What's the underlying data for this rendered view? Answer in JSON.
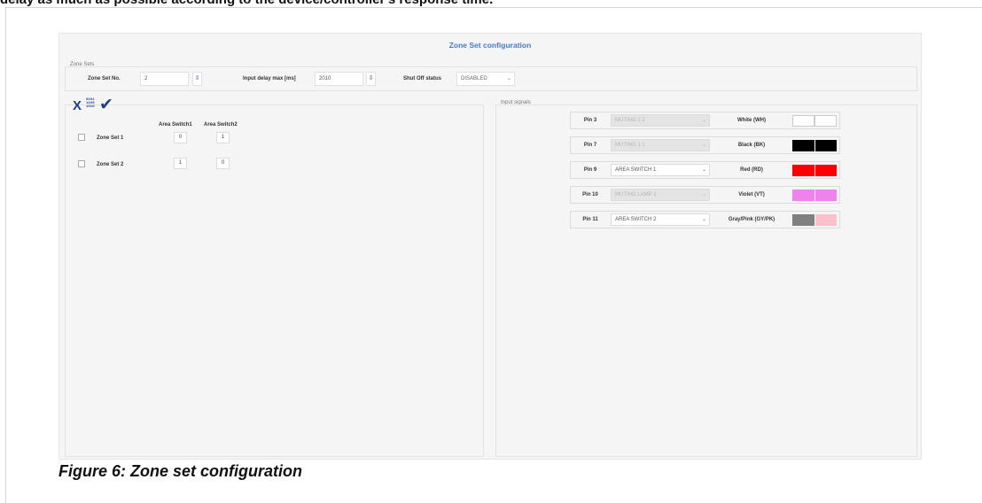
{
  "doc": {
    "top_text": "delay as much as possible according to the device/controller's response time.",
    "caption": "Figure 6: Zone set configuration"
  },
  "window": {
    "title": "Zone Set configuration"
  },
  "zone_sets_group": {
    "legend": "Zone Sets",
    "zone_set_no_label": "Zone Set No.",
    "zone_set_no_value": "2",
    "input_delay_label": "Input delay max [ms]",
    "input_delay_value": "2010",
    "shut_off_label": "Shut Off status",
    "shut_off_value": "DISABLED"
  },
  "toolbar": {
    "clear_icon": "x-icon",
    "binary_icon": "binary-icon",
    "binary_text": [
      "0101",
      "1100",
      "1010"
    ],
    "confirm_icon": "checkmark-icon",
    "icon_color": "#1f3f8a"
  },
  "zone_table": {
    "headers": [
      "Area Switch1",
      "Area Switch2"
    ],
    "rows": [
      {
        "label": "Zone Set 1",
        "checked": false,
        "area1": "0",
        "area2": "1"
      },
      {
        "label": "Zone Set 2",
        "checked": false,
        "area1": "1",
        "area2": "0"
      }
    ]
  },
  "input_signals": {
    "legend": "Input signals",
    "rows": [
      {
        "pin": "Pin 3",
        "function": "MUTING 1 2",
        "enabled": false,
        "wire": "White (WH)",
        "colors": [
          "#ffffff",
          "#ffffff"
        ]
      },
      {
        "pin": "Pin 7",
        "function": "MUTING 1 1",
        "enabled": false,
        "wire": "Black (BK)",
        "colors": [
          "#000000",
          "#000000"
        ]
      },
      {
        "pin": "Pin 9",
        "function": "AREA SWITCH 1",
        "enabled": true,
        "wire": "Red (RD)",
        "colors": [
          "#ff0000",
          "#ff0000"
        ]
      },
      {
        "pin": "Pin 10",
        "function": "MUTING LAMP 1",
        "enabled": false,
        "wire": "Violet (VT)",
        "colors": [
          "#ee82ee",
          "#ee82ee"
        ]
      },
      {
        "pin": "Pin 11",
        "function": "AREA SWITCH 2",
        "enabled": true,
        "wire": "Gray/Pink (GY/PK)",
        "colors": [
          "#808080",
          "#ffc0cb"
        ]
      }
    ]
  }
}
